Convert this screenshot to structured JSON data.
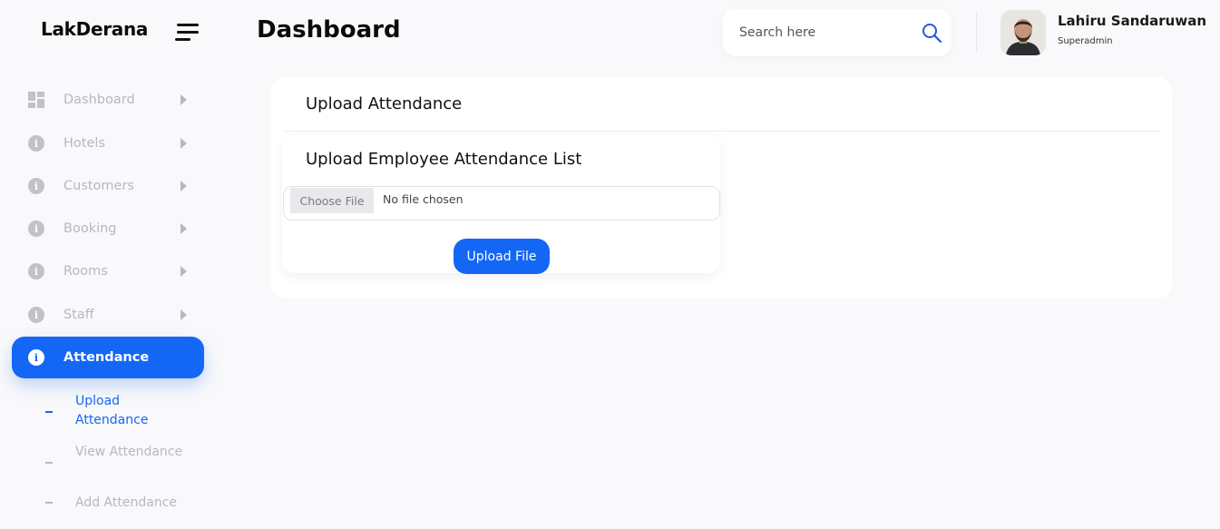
{
  "brand": "LakDerana",
  "header": {
    "page_title": "Dashboard",
    "search_placeholder": "Search here",
    "user_name": "Lahiru Sandaruwan",
    "user_role": "Superadmin"
  },
  "sidebar": {
    "items": [
      {
        "label": "Dashboard",
        "icon": "grid-icon"
      },
      {
        "label": "Hotels",
        "icon": "info-icon"
      },
      {
        "label": "Customers",
        "icon": "info-icon"
      },
      {
        "label": "Booking",
        "icon": "info-icon"
      },
      {
        "label": "Rooms",
        "icon": "info-icon"
      },
      {
        "label": "Staff",
        "icon": "info-icon"
      },
      {
        "label": "Attendance",
        "icon": "info-icon",
        "active": true
      }
    ],
    "subitems": [
      {
        "label": "Upload Attendance",
        "active": true
      },
      {
        "label": "View Attendance"
      },
      {
        "label": "Add Attendance"
      }
    ]
  },
  "main": {
    "card_title": "Upload Attendance",
    "inner_title": "Upload Employee Attendance List",
    "choose_file_label": "Choose File",
    "file_status": "No file chosen",
    "upload_button": "Upload File"
  },
  "colors": {
    "accent": "#1467f5",
    "background": "#f9f9fb",
    "muted_text": "#b8b8bd"
  }
}
